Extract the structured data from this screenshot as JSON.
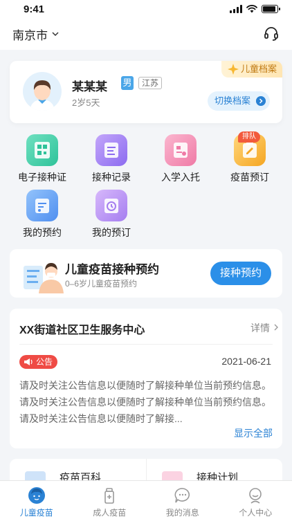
{
  "status_bar": {
    "time": "9:41"
  },
  "header": {
    "city": "南京市"
  },
  "profile": {
    "name": "某某某",
    "gender": "男",
    "province": "江苏",
    "age": "2岁5天",
    "archive_tag": "儿童档案",
    "switch_label": "切换档案"
  },
  "grid": [
    {
      "label": "电子接种证",
      "icon": "e-vaccination-certificate-icon",
      "color": "#3ccfa6"
    },
    {
      "label": "接种记录",
      "icon": "vaccination-record-icon",
      "color": "#9a7df0"
    },
    {
      "label": "入学入托",
      "icon": "school-enrollment-icon",
      "color": "#f28ab2"
    },
    {
      "label": "疫苗预订",
      "icon": "vaccine-order-icon",
      "color": "#f7b731",
      "badge": "排队"
    },
    {
      "label": "我的预约",
      "icon": "my-appointment-icon",
      "color": "#5b9ff0"
    },
    {
      "label": "我的预订",
      "icon": "my-order-icon",
      "color": "#b78af0"
    }
  ],
  "booking": {
    "title": "儿童疫苗接种预约",
    "subtitle": "0–6岁儿童疫苗预约",
    "button": "接种预约"
  },
  "center": {
    "name": "XX街道社区卫生服务中心",
    "detail_label": "详情",
    "notice_tag": "公告",
    "notice_date": "2021-06-21",
    "notice_text": "请及时关注公告信息以便随时了解接种单位当前预约信息。请及时关注公告信息以便随时了解接种单位当前预约信息。请及时关注公告信息以便随时了解接...",
    "show_all": "显示全部"
  },
  "bottom_cards": [
    {
      "label": "疫苗百科",
      "color": "#7ab6f2"
    },
    {
      "label": "接种计划",
      "color": "#f29ab8"
    }
  ],
  "tabs": [
    {
      "label": "儿童疫苗",
      "active": true
    },
    {
      "label": "成人疫苗",
      "active": false
    },
    {
      "label": "我的消息",
      "active": false
    },
    {
      "label": "个人中心",
      "active": false
    }
  ]
}
